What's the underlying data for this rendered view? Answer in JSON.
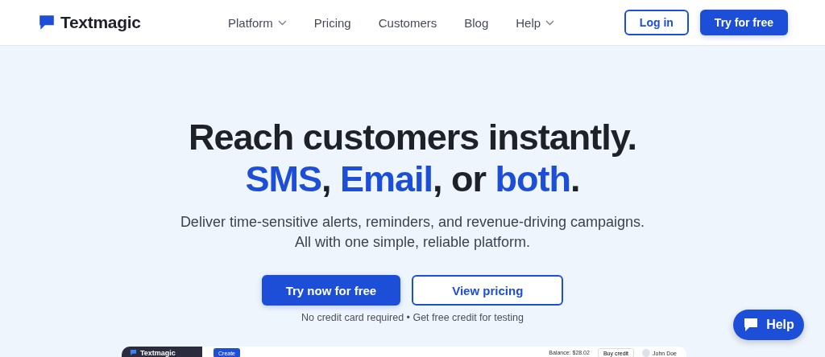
{
  "header": {
    "logo": "Textmagic",
    "nav": [
      {
        "label": "Platform",
        "dropdown": true
      },
      {
        "label": "Pricing",
        "dropdown": false
      },
      {
        "label": "Customers",
        "dropdown": false
      },
      {
        "label": "Blog",
        "dropdown": false
      },
      {
        "label": "Help",
        "dropdown": true
      }
    ],
    "login": "Log in",
    "cta": "Try for free"
  },
  "hero": {
    "headline": "Reach customers instantly.",
    "subheadline": [
      {
        "text": "SMS",
        "accent": true
      },
      {
        "text": ", ",
        "accent": false
      },
      {
        "text": "Email",
        "accent": true
      },
      {
        "text": ", or ",
        "accent": false
      },
      {
        "text": "both",
        "accent": true
      },
      {
        "text": ".",
        "accent": false
      }
    ],
    "description": [
      "Deliver time-sensitive alerts, reminders, and revenue-driving campaigns.",
      "All with one simple, reliable platform."
    ],
    "primary_button": "Try now for free",
    "secondary_button": "View pricing",
    "note": "No credit card required • Get free credit for testing"
  },
  "app_preview": {
    "logo": "Textmagic",
    "create_button": "Create",
    "balance": "Balance: $28.02",
    "buy_credit": "Buy credit",
    "user": "John Doe"
  },
  "help_button": "Help"
}
